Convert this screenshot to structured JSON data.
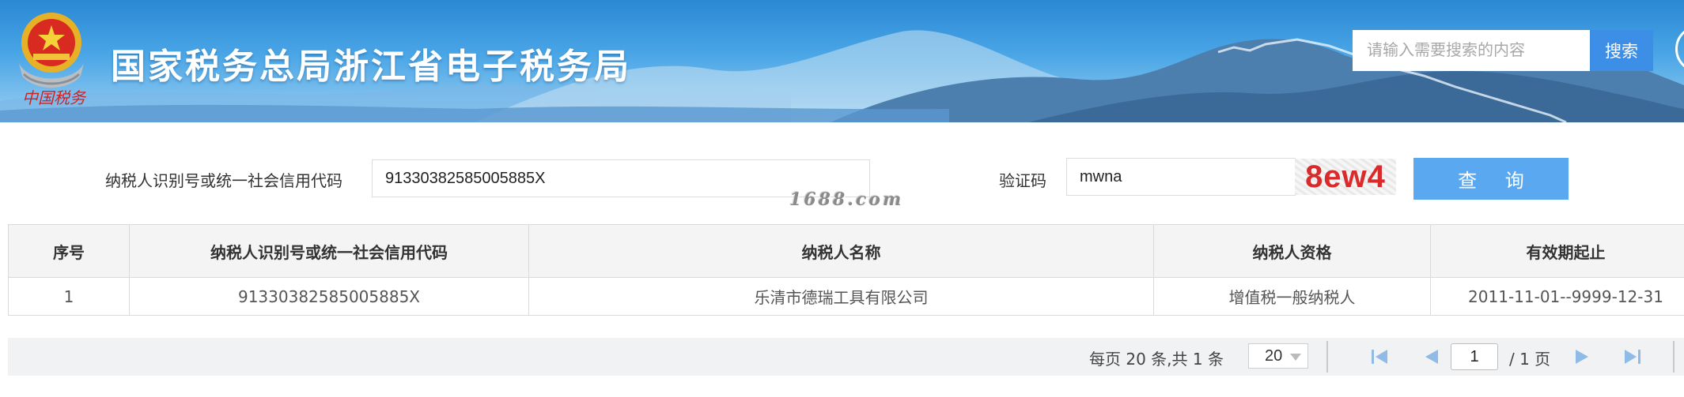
{
  "header": {
    "site_title": "国家税务总局浙江省电子税务局",
    "motto": "中国税务",
    "search_placeholder": "请输入需要搜索的内容",
    "search_button": "搜索"
  },
  "query": {
    "taxid_label": "纳税人识别号或统一社会信用代码",
    "taxid_value": "91330382585005885X",
    "captcha_label": "验证码",
    "captcha_value": "mwna",
    "captcha_image_text": "8ew4",
    "query_button": "查 询"
  },
  "watermark": "1688.com",
  "table": {
    "headers": [
      "序号",
      "纳税人识别号或统一社会信用代码",
      "纳税人名称",
      "纳税人资格",
      "有效期起止"
    ],
    "rows": [
      [
        "1",
        "91330382585005885X",
        "乐清市德瑞工具有限公司",
        "增值税一般纳税人",
        "2011-11-01--9999-12-31"
      ]
    ]
  },
  "pagination": {
    "summary": "每页 20 条,共 1 条",
    "page_size": "20",
    "current_page": "1",
    "total_pages": "/ 1 页"
  },
  "colors": {
    "banner": "#3a98dc",
    "search_button": "#3d8ee6",
    "query_button": "#5aa8ef",
    "captcha_text": "#d92b2b",
    "nav_icon": "#8fbbe6"
  }
}
